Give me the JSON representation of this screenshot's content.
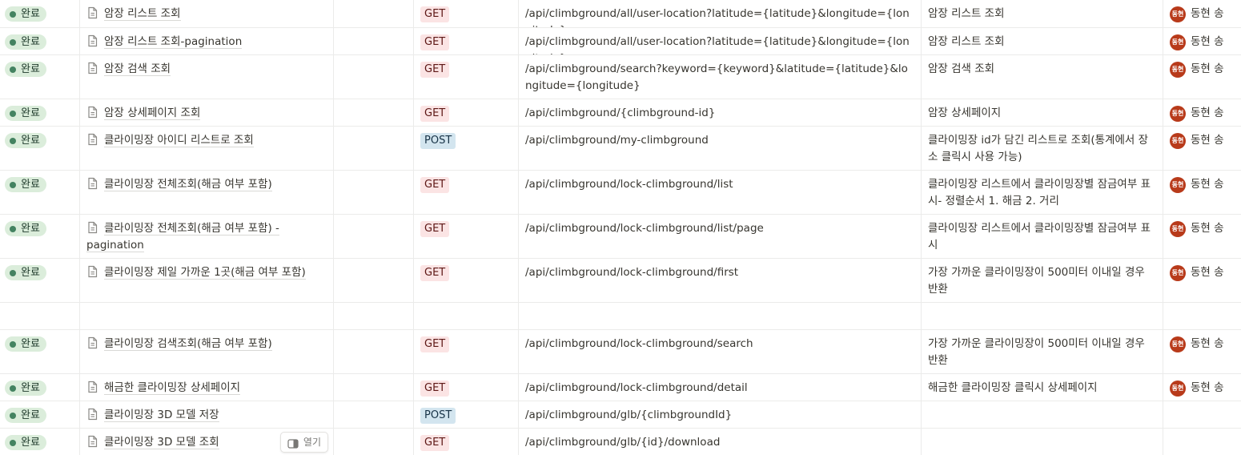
{
  "colors": {
    "status_bg": "#dbeddb",
    "status_dot": "#448361",
    "get_bg": "#fbe4e4",
    "post_bg": "#d3e5ef",
    "avatar_bg": "#b83a1a"
  },
  "icons": {
    "page": "page-icon",
    "open": "side-panel-icon"
  },
  "open_button_label": "열기",
  "rows": [
    {
      "status": "완료",
      "name": "암장 리스트 조회",
      "method": "GET",
      "url": "/api/climbground/all/user-location?latitude={latitude}&longitude={longitude}",
      "desc": "암장 리스트 조회",
      "avatar": "동현",
      "person": "동현 송"
    },
    {
      "status": "완료",
      "name": "암장 리스트 조회-pagination",
      "method": "GET",
      "url": "/api/climbground/all/user-location?latitude={latitude}&longitude={longitude}",
      "desc": "암장 리스트 조회",
      "avatar": "동현",
      "person": "동현 송"
    },
    {
      "status": "완료",
      "name": "암장 검색 조회",
      "method": "GET",
      "url": "/api/climbground/search?keyword={keyword}&latitude={latitude}&longitude={longitude}",
      "desc": "암장 검색 조회",
      "avatar": "동현",
      "person": "동현 송"
    },
    {
      "status": "완료",
      "name": "암장 상세페이지 조회",
      "method": "GET",
      "url": "/api/climbground/{climbground-id}",
      "desc": "암장 상세페이지",
      "avatar": "동현",
      "person": "동현 송"
    },
    {
      "status": "완료",
      "name": "클라이밍장 아이디 리스트로 조회",
      "method": "POST",
      "url": "/api/climbground/my-climbground",
      "desc": "클라이밍장 id가 담긴 리스트로 조회(통계에서 장소 클릭시 사용 가능)",
      "avatar": "동현",
      "person": "동현 송"
    },
    {
      "status": "완료",
      "name": "클라이밍장 전체조회(해금 여부 포함)",
      "method": "GET",
      "url": "/api/climbground/lock-climbground/list",
      "desc": "클라이밍장 리스트에서 클라이밍장별 잠금여부 표시- 정렬순서 1. 해금 2. 거리",
      "avatar": "동현",
      "person": "동현 송"
    },
    {
      "status": "완료",
      "name": "클라이밍장 전체조회(해금 여부 포함) - pagination",
      "method": "GET",
      "url": "/api/climbground/lock-climbground/list/page",
      "desc": "클라이밍장 리스트에서 클라이밍장별 잠금여부 표시",
      "avatar": "동현",
      "person": "동현 송"
    },
    {
      "status": "완료",
      "name": "클라이밍장 제일 가까운 1곳(해금 여부 포함)",
      "method": "GET",
      "url": "/api/climbground/lock-climbground/first",
      "desc": "가장 가까운 클라이밍장이 500미터 이내일 경우 반환",
      "avatar": "동현",
      "person": "동현 송"
    },
    {
      "empty": true
    },
    {
      "status": "완료",
      "name": "클라이밍장 검색조회(해금 여부 포함)",
      "method": "GET",
      "url": "/api/climbground/lock-climbground/search",
      "desc": "가장 가까운 클라이밍장이 500미터 이내일 경우 반환",
      "avatar": "동현",
      "person": "동현 송"
    },
    {
      "status": "완료",
      "name": "해금한 클라이밍장 상세페이지",
      "method": "GET",
      "url": "/api/climbground/lock-climbground/detail",
      "desc": "해금한 클라이밍장 클릭시 상세페이지",
      "avatar": "동현",
      "person": "동현 송"
    },
    {
      "status": "완료",
      "name": "클라이밍장 3D 모델 저장",
      "method": "POST",
      "url": "/api/climbground/glb/{climbgroundId}",
      "desc": "",
      "avatar": "",
      "person": ""
    },
    {
      "status": "완료",
      "name": "클라이밍장 3D 모델 조회",
      "method": "GET",
      "url": "/api/climbground/glb/{id}/download",
      "desc": "",
      "avatar": "",
      "person": "",
      "hover": true
    }
  ]
}
